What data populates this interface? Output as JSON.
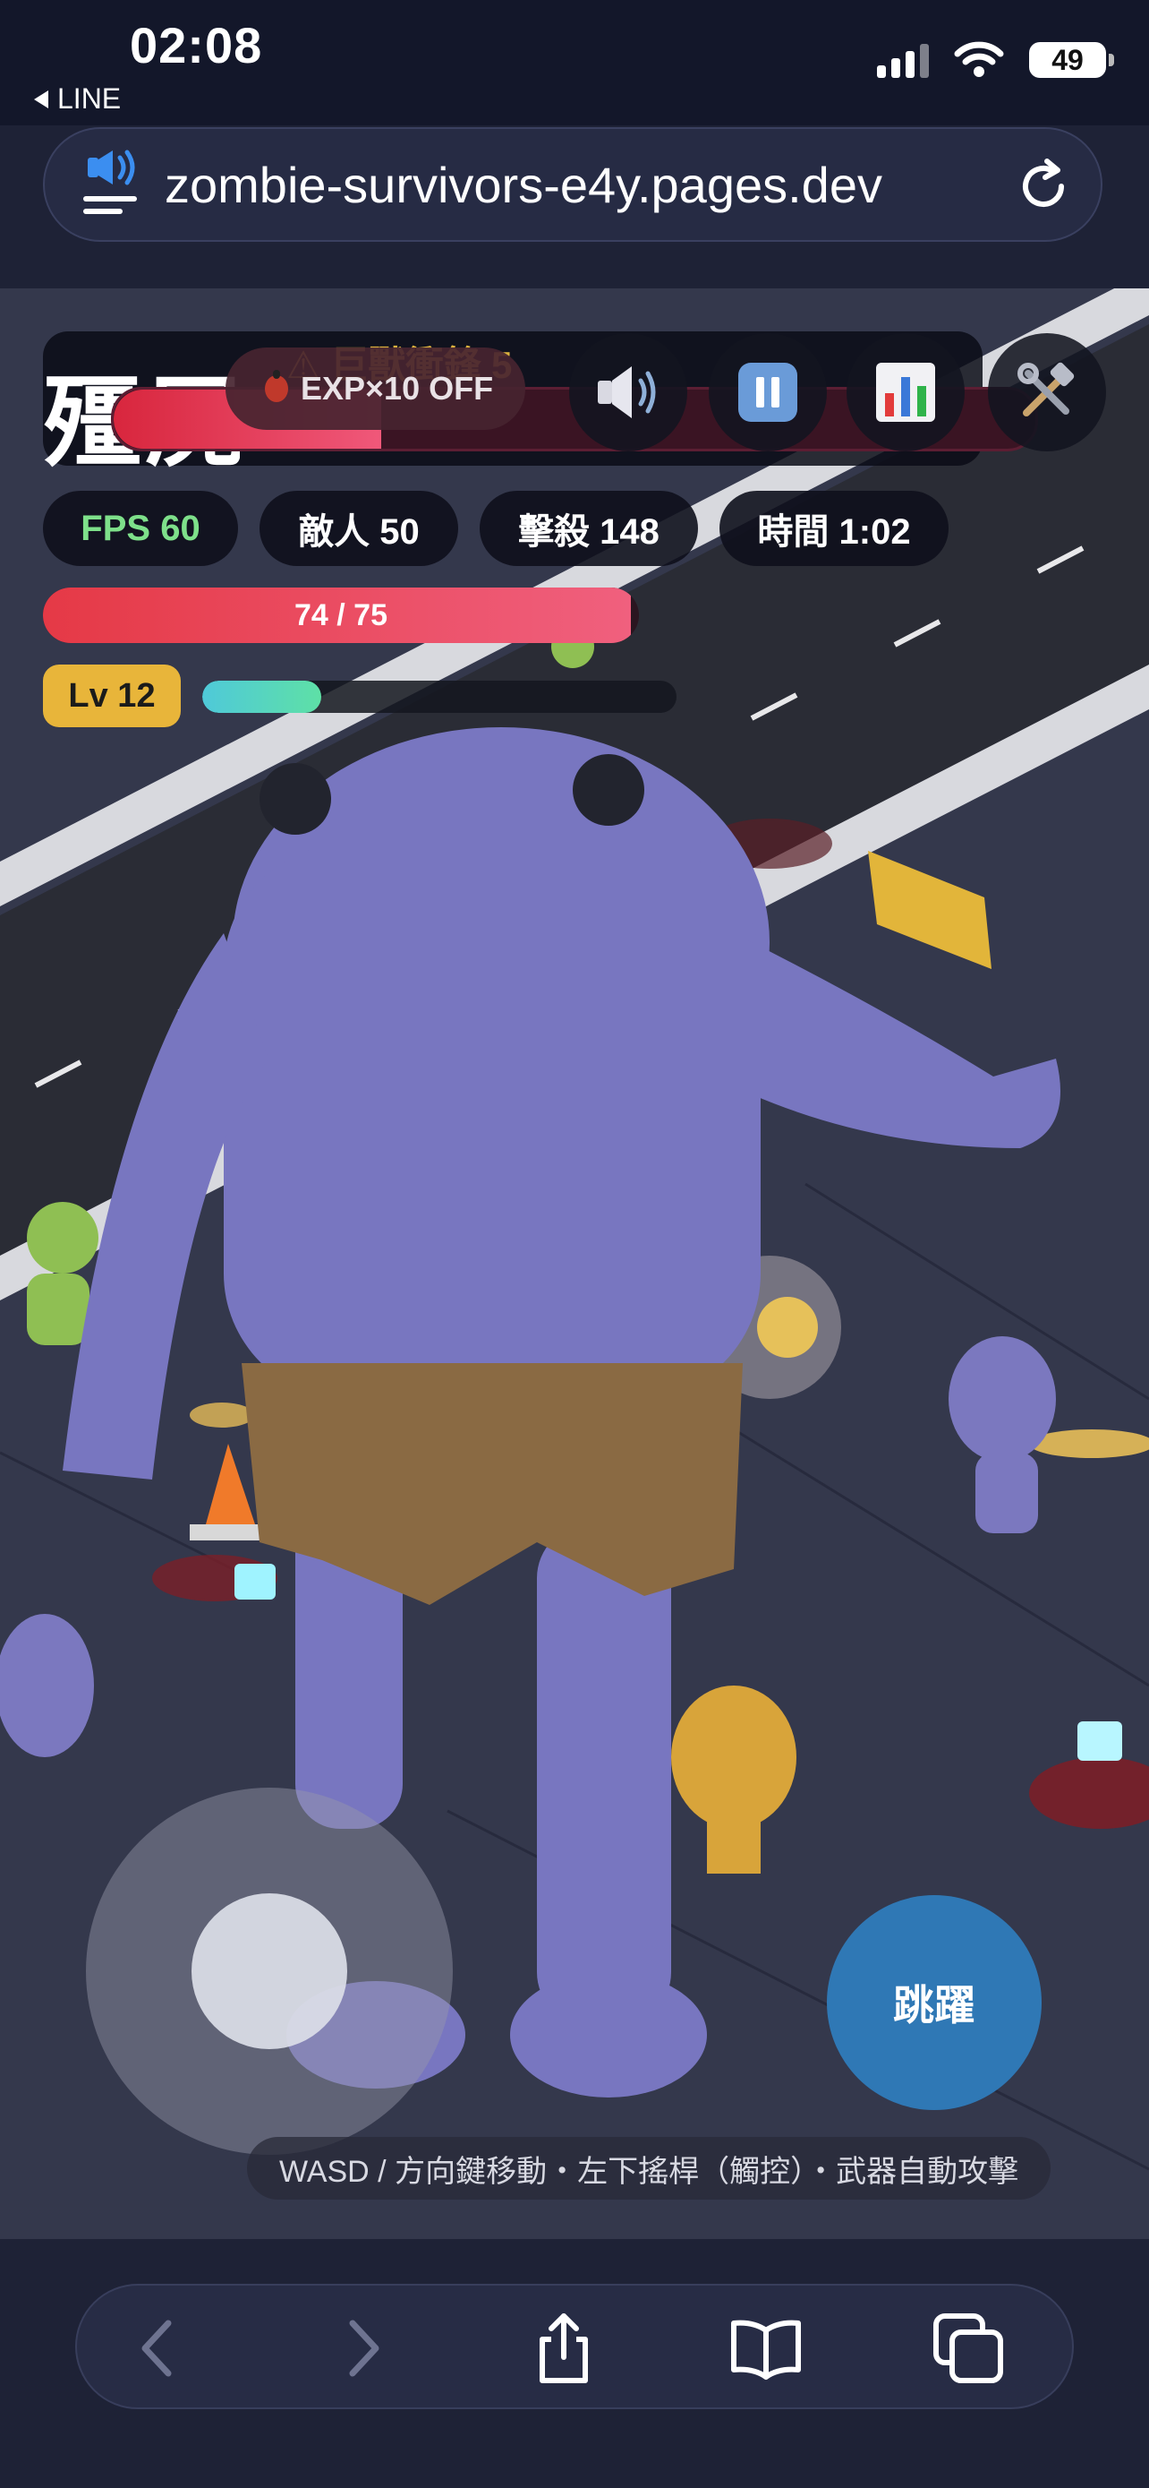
{
  "status_bar": {
    "time": "02:08",
    "back_app": "LINE",
    "battery": "49"
  },
  "browser": {
    "url": "zombie-survivors-e4y.pages.dev",
    "audio_icon": "speaker-wave-icon",
    "reload_icon": "reload-icon"
  },
  "game": {
    "title": "殭屍",
    "warning": "⚠ 巨獸衝鋒 5",
    "boss_hp_fraction": 0.29,
    "exp_chip": "EXP×10 OFF",
    "buttons": {
      "sound_icon": "speaker-icon",
      "pause_icon": "pause-icon",
      "stats_icon": "bar-chart-icon",
      "settings_icon": "tools-icon"
    },
    "stats": {
      "fps": "FPS 60",
      "enemies": "敵人 50",
      "kills": "擊殺 148",
      "time": "時間 1:02"
    },
    "hp": {
      "text": "74 / 75",
      "current": 74,
      "max": 75
    },
    "level": {
      "text": "Lv 12",
      "xp_fraction": 0.25
    },
    "jump_label": "跳躍",
    "help": "WASD / 方向鍵移動・左下搖桿（觸控）・武器自動攻擊",
    "colors": {
      "fps_text": "#7ee08a",
      "hp_fill": "#e53946",
      "level_badge": "#e8b53a",
      "jump_button": "#2f78b5"
    }
  },
  "toolbar": {
    "back_icon": "chevron-left-icon",
    "forward_icon": "chevron-right-icon",
    "share_icon": "share-icon",
    "bookmarks_icon": "book-icon",
    "tabs_icon": "tabs-icon"
  }
}
